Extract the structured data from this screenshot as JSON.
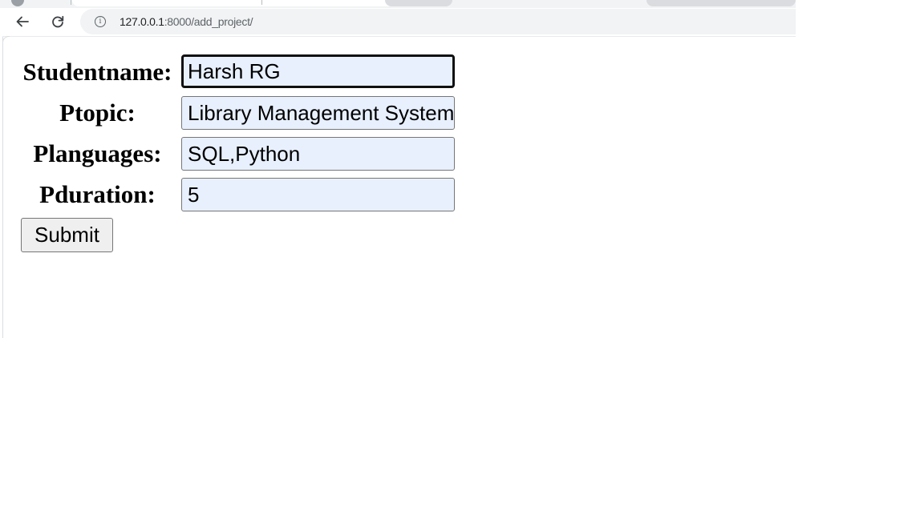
{
  "browser": {
    "url_host": "127.0.0.1",
    "url_path": ":8000/add_project/"
  },
  "form": {
    "studentname_label": "Studentname:",
    "studentname_value": "Harsh RG",
    "ptopic_label": "Ptopic:",
    "ptopic_value": "Library Management System",
    "planguages_label": "Planguages:",
    "planguages_value": "SQL,Python",
    "pduration_label": "Pduration:",
    "pduration_value": "5",
    "submit_label": "Submit"
  },
  "icons": {
    "back": "back-arrow-icon",
    "reload": "reload-icon",
    "info": "info-icon"
  },
  "colors": {
    "autofill_background": "#e8f0fe",
    "omnibox_background": "#f1f3f4"
  }
}
